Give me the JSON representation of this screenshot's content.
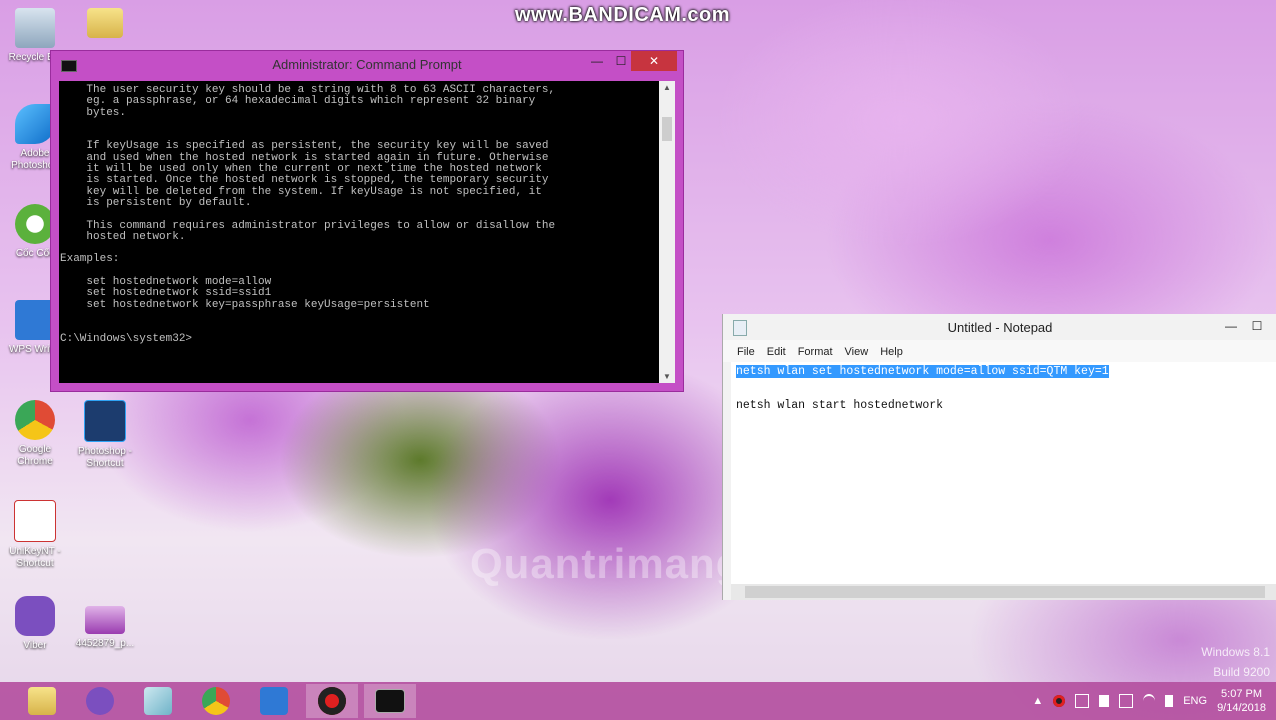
{
  "watermark": "www.BANDICAM.com",
  "desktop_icons": [
    {
      "label": "Recycle Bin",
      "color": "#b0c4d8"
    },
    {
      "label": "Adobe Photoshop",
      "color": "#3a8fd8"
    },
    {
      "label": "Cốc Cốc",
      "color": "#5bb13c"
    },
    {
      "label": "WPS Writer",
      "color": "#2f79d5"
    },
    {
      "label": "Google Chrome",
      "color": "#e04b35"
    },
    {
      "label": "Photoshop - Shortcut",
      "color": "#1c3c6e"
    },
    {
      "label": "UniKeyNT - Shortcut",
      "color": "#ffffff"
    },
    {
      "label": "Viber",
      "color": "#7b4fbf"
    },
    {
      "label": "4452879_p...",
      "color": "#c06ad0"
    }
  ],
  "cmd": {
    "title": "Administrator: Command Prompt",
    "minimize": "—",
    "maximize": "☐",
    "close": "✕",
    "console_text": "    The user security key should be a string with 8 to 63 ASCII characters,\n    eg. a passphrase, or 64 hexadecimal digits which represent 32 binary\n    bytes.\n\n\n    If keyUsage is specified as persistent, the security key will be saved\n    and used when the hosted network is started again in future. Otherwise\n    it will be used only when the current or next time the hosted network\n    is started. Once the hosted network is stopped, the temporary security\n    key will be deleted from the system. If keyUsage is not specified, it\n    is persistent by default.\n\n    This command requires administrator privileges to allow or disallow the\n    hosted network.\n\nExamples:\n\n    set hostednetwork mode=allow\n    set hostednetwork ssid=ssid1\n    set hostednetwork key=passphrase keyUsage=persistent\n\n\nC:\\Windows\\system32>"
  },
  "notepad": {
    "title": "Untitled - Notepad",
    "minimize": "—",
    "maximize": "☐",
    "menu": [
      "File",
      "Edit",
      "Format",
      "View",
      "Help"
    ],
    "lines": [
      {
        "text": "netsh wlan set hostednetwork mode=allow ssid=QTM key=1",
        "selected": true
      },
      {
        "text": "",
        "selected": false
      },
      {
        "text": "netsh wlan start hostednetwork",
        "selected": false
      }
    ]
  },
  "bg_watermark": "Quantrimang",
  "win_version": [
    "Windows 8.1",
    "Build 9200"
  ],
  "taskbar": {
    "items": [
      "file-explorer",
      "viber",
      "notepad",
      "chrome",
      "wps-writer",
      "bandicam",
      "command-prompt"
    ],
    "tray": {
      "language": "ENG",
      "time": "5:07 PM",
      "date": "9/14/2018"
    }
  }
}
